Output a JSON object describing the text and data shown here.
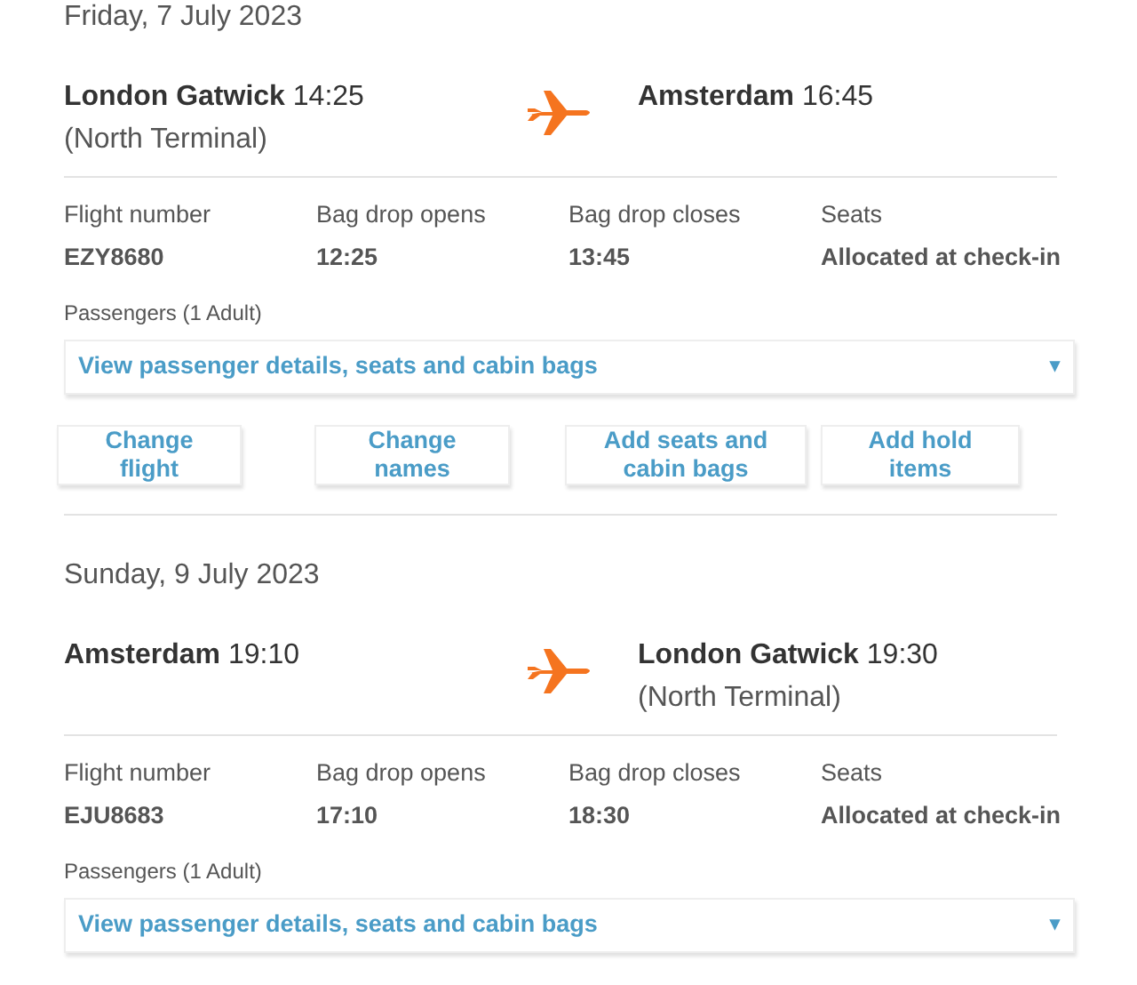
{
  "flights": [
    {
      "date": "Friday, 7 July 2023",
      "origin": {
        "place": "London Gatwick",
        "time": "14:25",
        "terminal": "(North Terminal)"
      },
      "destination": {
        "place": "Amsterdam",
        "time": "16:45"
      },
      "details": [
        {
          "label": "Flight number",
          "value": "EZY8680"
        },
        {
          "label": "Bag drop opens",
          "value": "12:25"
        },
        {
          "label": "Bag drop closes",
          "value": "13:45"
        },
        {
          "label": "Seats",
          "value": "Allocated at check-in"
        }
      ],
      "passengers_label": "Passengers (1 Adult)",
      "dropdown": {
        "label": "View passenger details, seats and cabin bags",
        "caret": "▾"
      },
      "buttons": [
        "Change flight",
        "Change names",
        "Add seats and cabin bags",
        "Add hold items"
      ]
    },
    {
      "date": "Sunday, 9 July 2023",
      "origin": {
        "place": "Amsterdam",
        "time": "19:10"
      },
      "destination": {
        "place": "London Gatwick",
        "time": "19:30",
        "terminal": "(North Terminal)"
      },
      "details": [
        {
          "label": "Flight number",
          "value": "EJU8683"
        },
        {
          "label": "Bag drop opens",
          "value": "17:10"
        },
        {
          "label": "Bag drop closes",
          "value": "18:30"
        },
        {
          "label": "Seats",
          "value": "Allocated at check-in"
        }
      ],
      "passengers_label": "Passengers (1 Adult)",
      "dropdown": {
        "label": "View passenger details, seats and cabin bags",
        "caret": "▾"
      }
    }
  ]
}
